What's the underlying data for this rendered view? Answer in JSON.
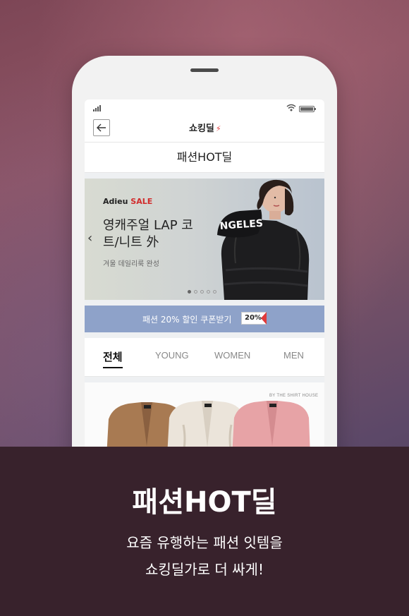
{
  "colors": {
    "accent_red": "#e03a3a",
    "coupon_bar": "#8ea2c9",
    "caption_bg": "#38222c"
  },
  "app": {
    "logo_text": "쇼킹딜",
    "back_icon": "arrow-left-icon"
  },
  "page": {
    "title": "패션HOT딜"
  },
  "banner": {
    "sale_prefix": "Adieu",
    "sale_word": "SALE",
    "headline": "영캐주얼 LAP 코트/니트 外",
    "subcopy": "겨울 데일리룩 완성",
    "hood_text": "NGELES",
    "slide_index": 1,
    "slide_count": 5
  },
  "coupon": {
    "text": "패션 20% 할인 쿠폰받기",
    "badge": "20%"
  },
  "tabs": [
    {
      "label": "전체",
      "active": true
    },
    {
      "label": "YOUNG",
      "active": false
    },
    {
      "label": "WOMEN",
      "active": false
    },
    {
      "label": "MEN",
      "active": false
    }
  ],
  "product": {
    "brand": "BY THE SHIRT HOUSE"
  },
  "caption": {
    "title": "패션HOT딜",
    "line1": "요즘 유행하는 패션 잇템을",
    "line2": "쇼킹딜가로 더 싸게!"
  }
}
